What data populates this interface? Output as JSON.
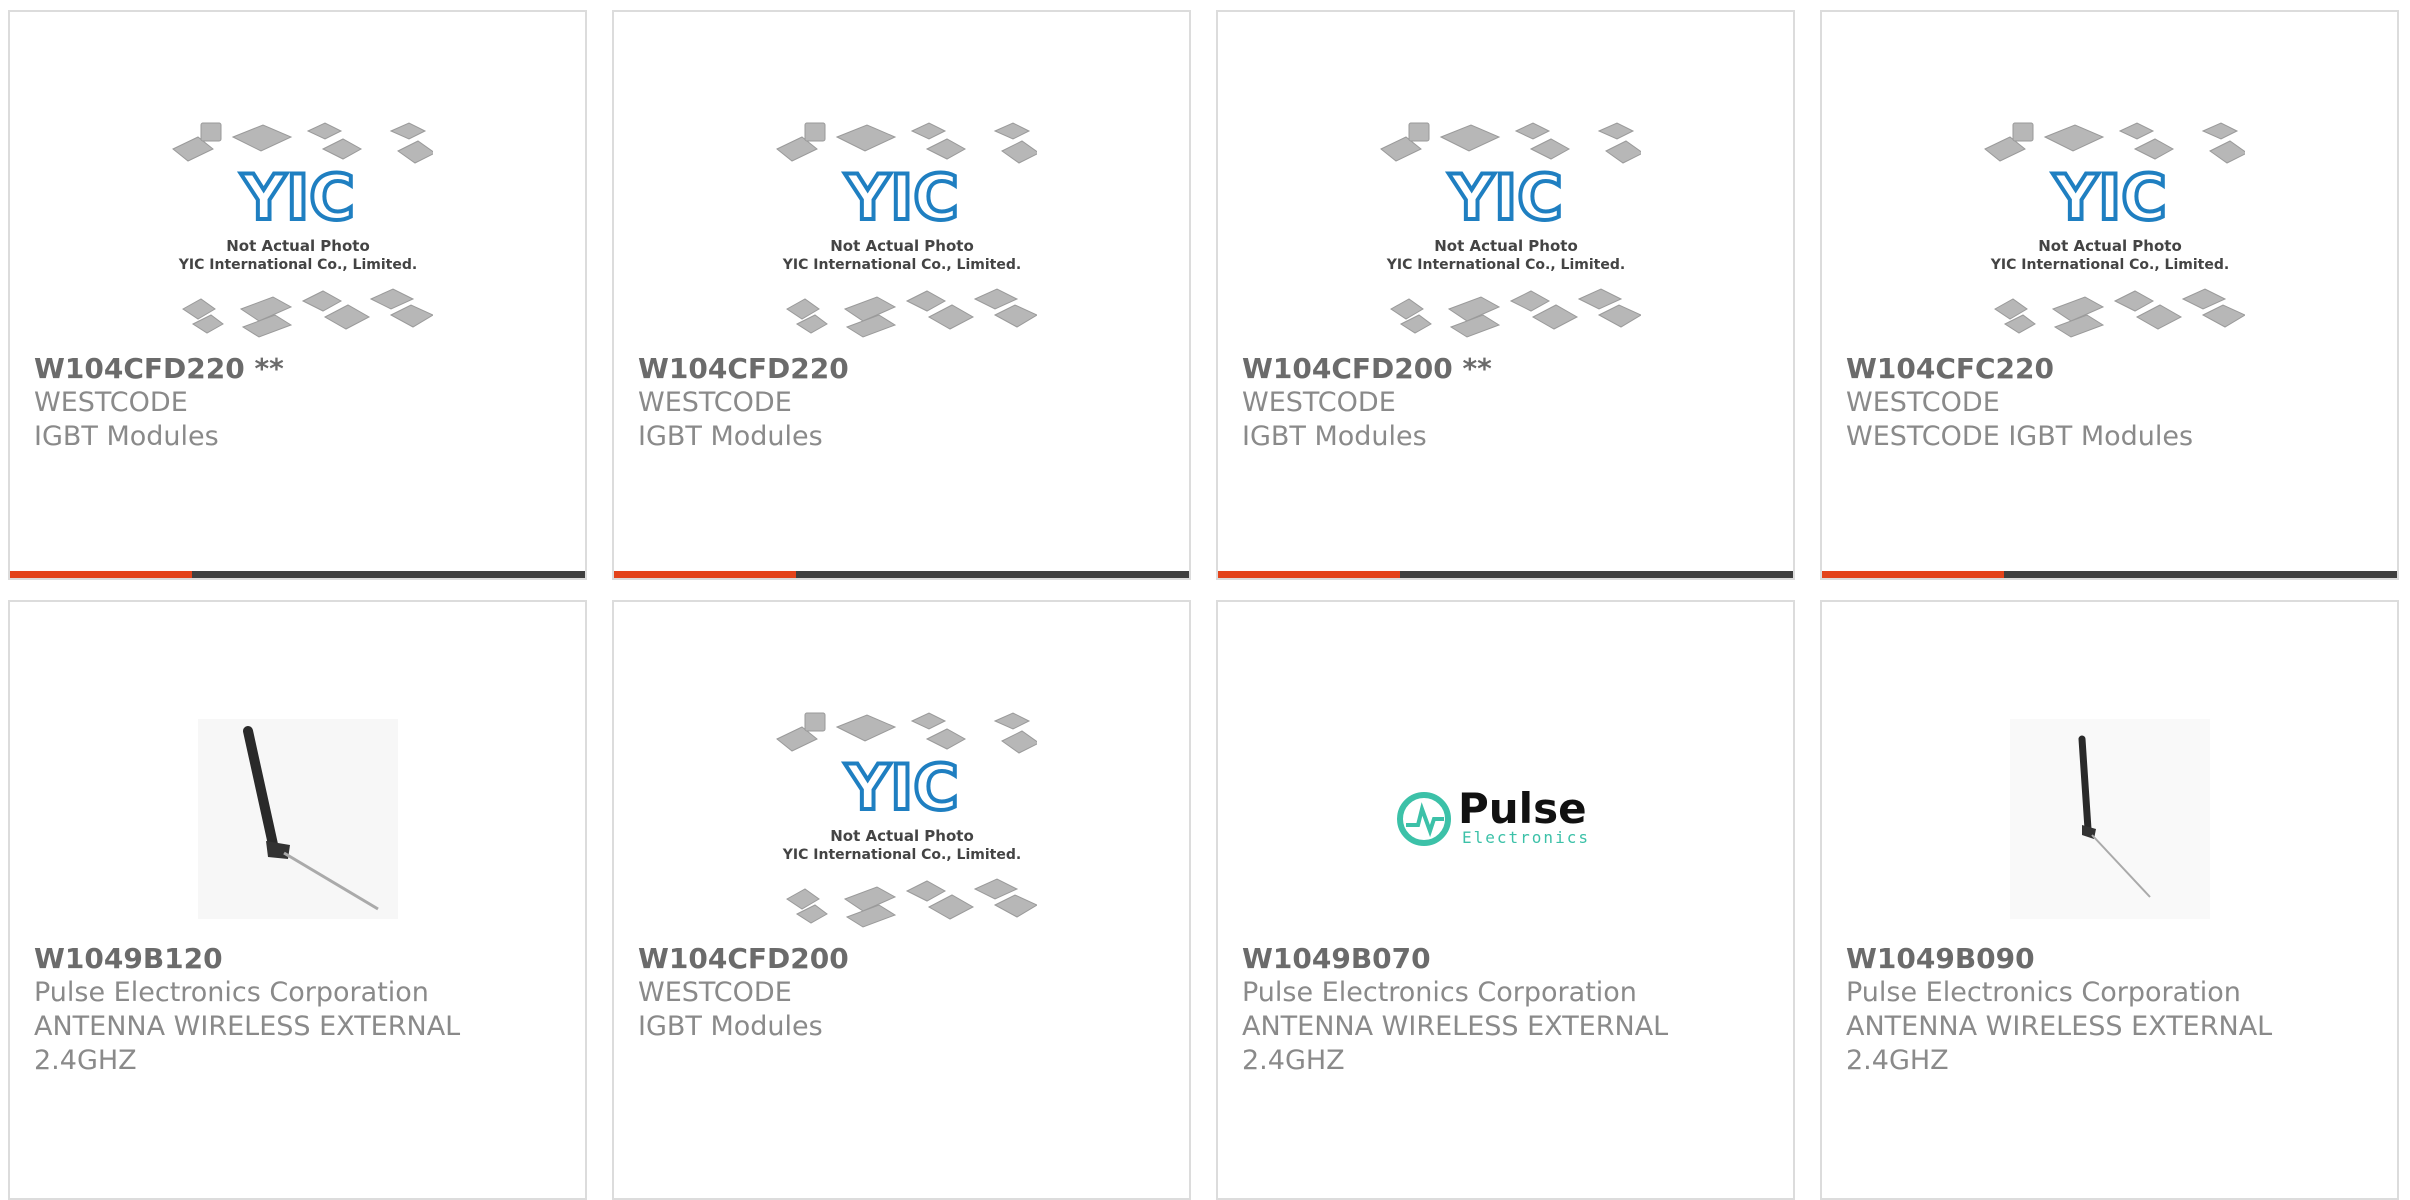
{
  "products": [
    {
      "part_number": "W104CFD220 **",
      "manufacturer": "WESTCODE",
      "description": "IGBT Modules",
      "image": "placeholder",
      "placeholder_line1": "Not Actual Photo",
      "placeholder_line2": "YIC International Co., Limited."
    },
    {
      "part_number": "W104CFD220",
      "manufacturer": "WESTCODE",
      "description": "IGBT Modules",
      "image": "placeholder",
      "placeholder_line1": "Not Actual Photo",
      "placeholder_line2": "YIC International Co., Limited."
    },
    {
      "part_number": "W104CFD200 **",
      "manufacturer": "WESTCODE",
      "description": "IGBT Modules",
      "image": "placeholder",
      "placeholder_line1": "Not Actual Photo",
      "placeholder_line2": "YIC International Co., Limited."
    },
    {
      "part_number": "W104CFC220",
      "manufacturer": "WESTCODE",
      "description": "WESTCODE IGBT Modules",
      "image": "placeholder",
      "placeholder_line1": "Not Actual Photo",
      "placeholder_line2": "YIC International Co., Limited."
    },
    {
      "part_number": "W1049B120",
      "manufacturer": "Pulse Electronics Corporation",
      "description": "ANTENNA WIRELESS EXTERNAL",
      "description_line2": "2.4GHZ",
      "image": "antenna-photo"
    },
    {
      "part_number": "W104CFD200",
      "manufacturer": "WESTCODE",
      "description": "IGBT Modules",
      "image": "placeholder",
      "placeholder_line1": "Not Actual Photo",
      "placeholder_line2": "YIC International Co., Limited."
    },
    {
      "part_number": "W1049B070",
      "manufacturer": "Pulse Electronics Corporation",
      "description": "ANTENNA WIRELESS EXTERNAL",
      "description_line2": "2.4GHZ",
      "image": "pulse-logo",
      "logo_word": "Pulse",
      "logo_subword": "Electronics"
    },
    {
      "part_number": "W1049B090",
      "manufacturer": "Pulse Electronics Corporation",
      "description": "ANTENNA WIRELESS EXTERNAL",
      "description_line2": "2.4GHZ",
      "image": "antenna-photo"
    }
  ],
  "colors": {
    "accent": "#e3431b",
    "bar": "#3f3f3f",
    "yic_blue": "#1f7fc1",
    "pulse_teal": "#3cc1a8"
  }
}
